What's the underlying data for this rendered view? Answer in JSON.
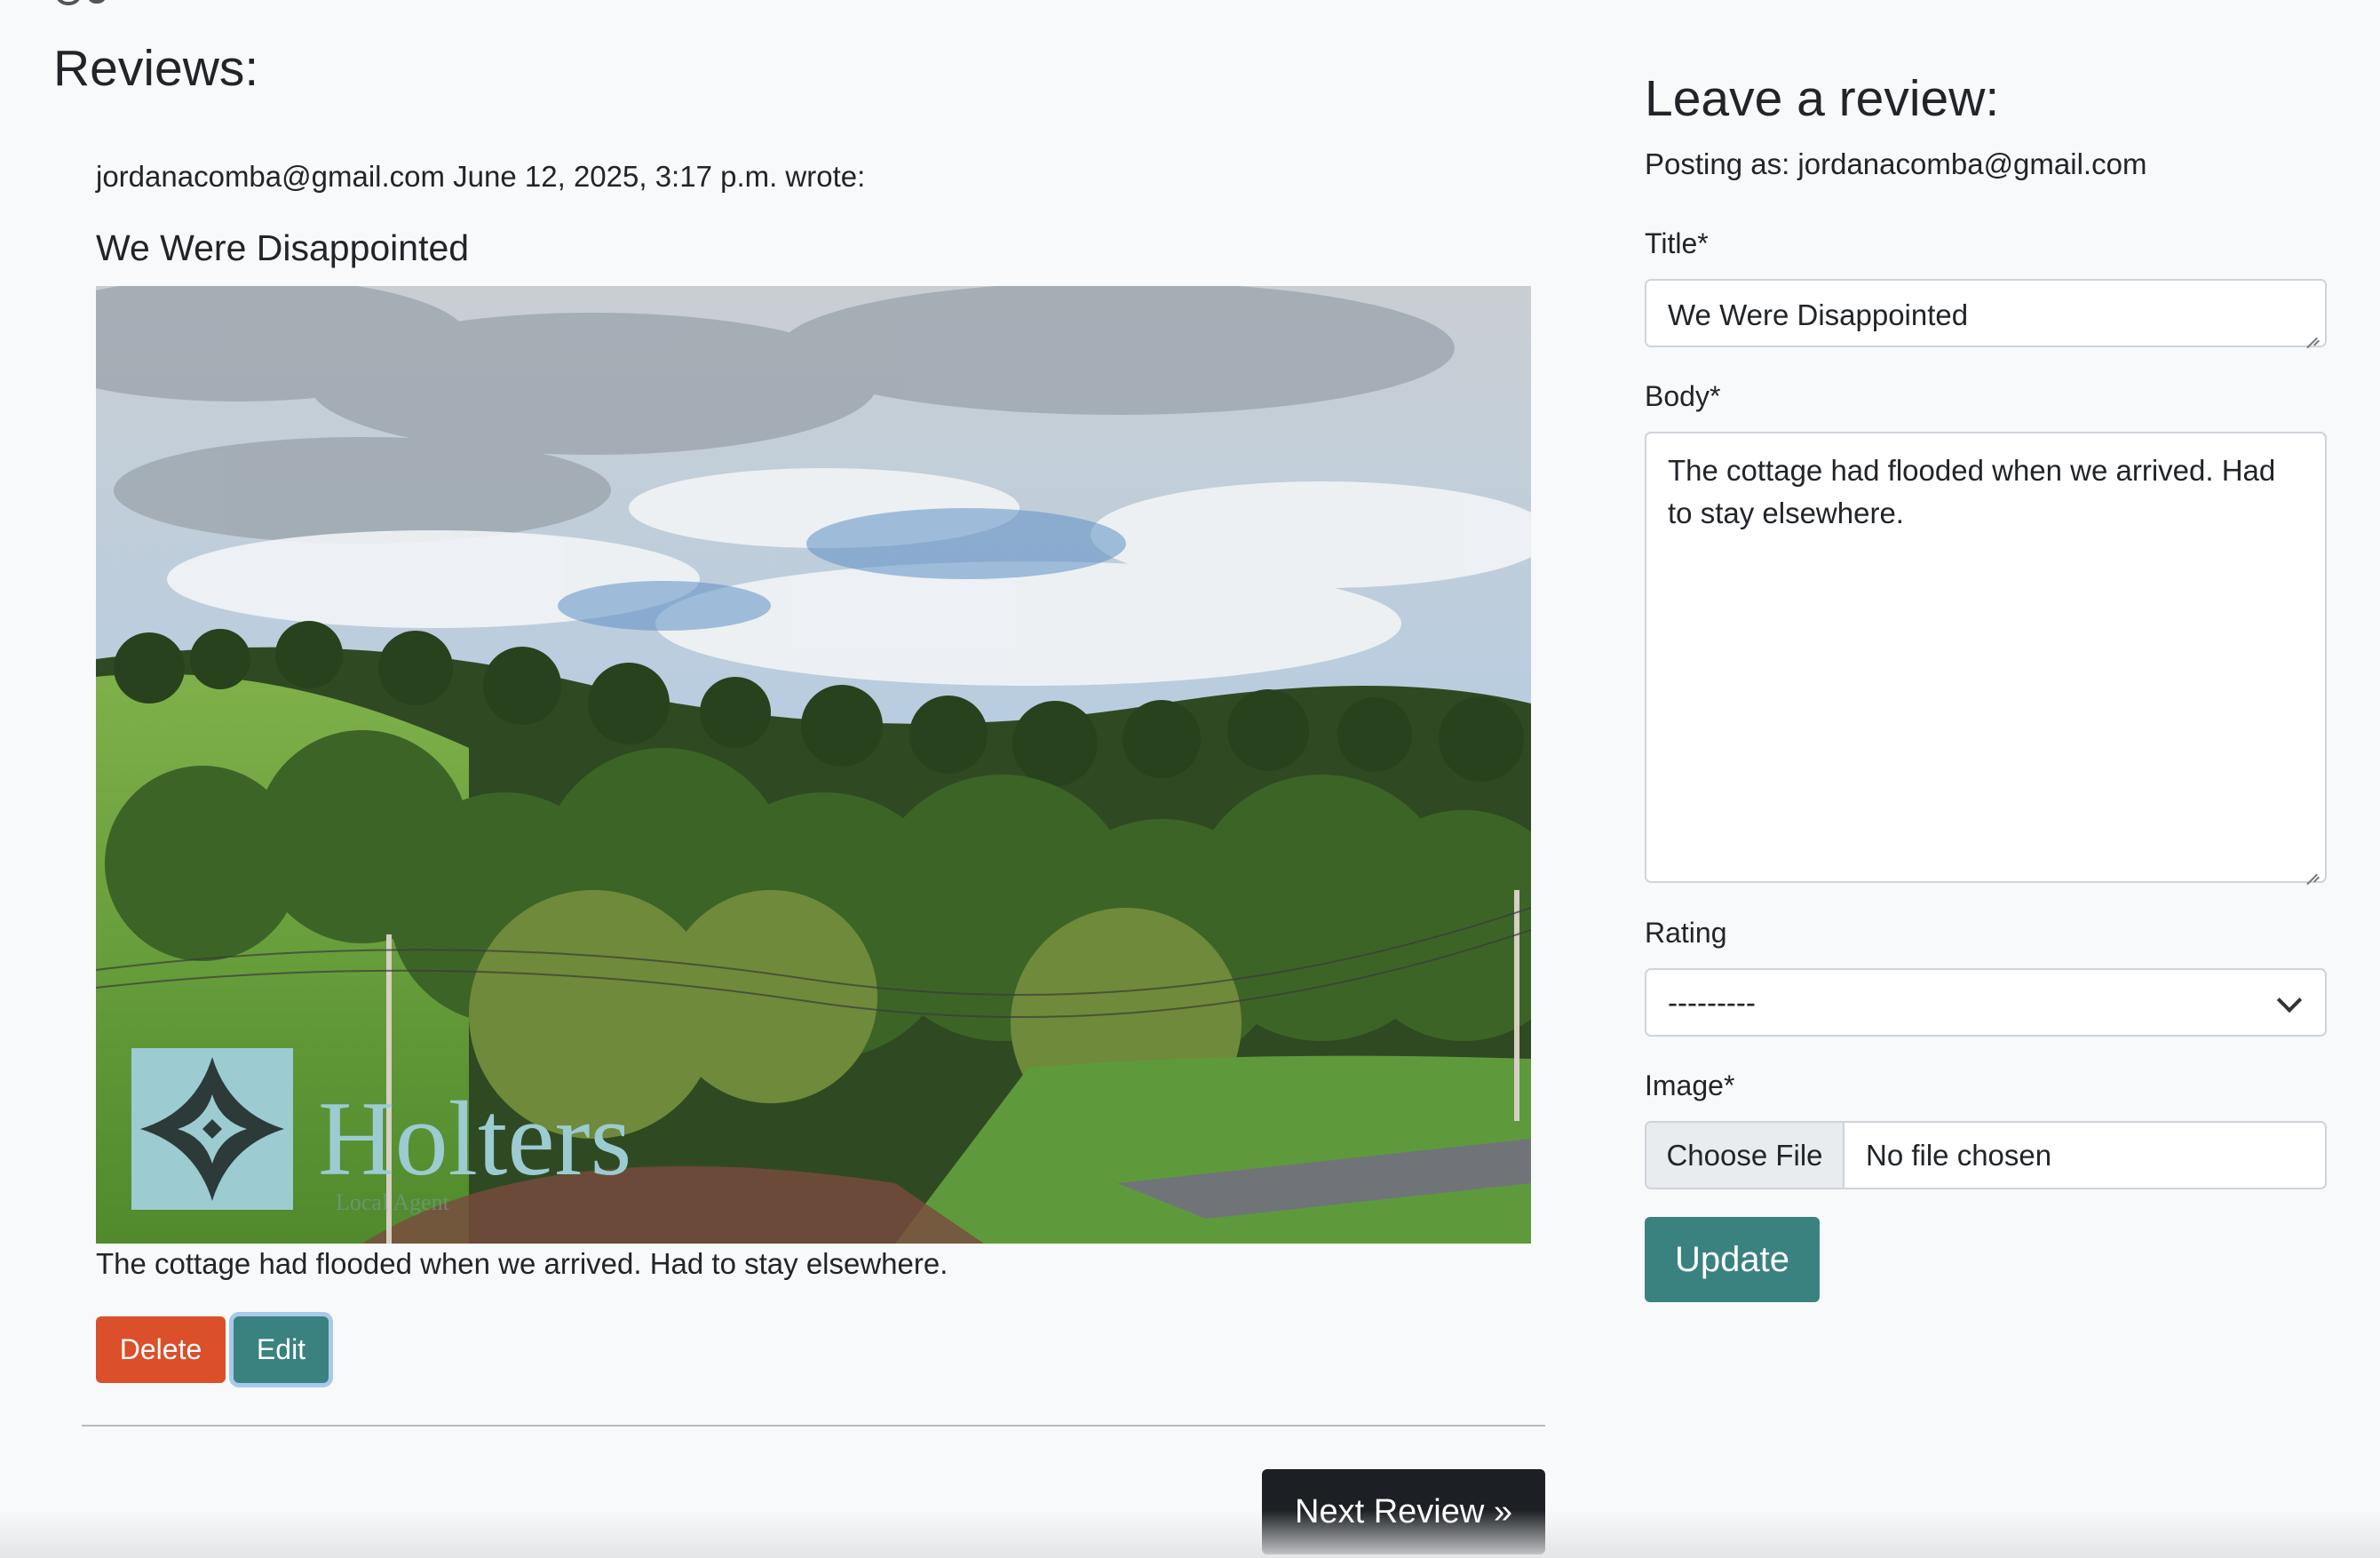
{
  "reviews": {
    "heading": "Reviews:",
    "meta": "jordanacomba@gmail.com June 12, 2025, 3:17 p.m. wrote:",
    "title": "We Were Disappointed",
    "image_watermark": "Holters",
    "image_watermark_tagline": "Local Agent",
    "body": "The cottage had flooded when we arrived. Had to stay elsewhere.",
    "delete_label": "Delete",
    "edit_label": "Edit",
    "next_label": "Next Review »"
  },
  "form": {
    "heading": "Leave a review:",
    "posting_as": "Posting as: jordanacomba@gmail.com",
    "title_label": "Title*",
    "title_value": "We Were Disappointed",
    "body_label": "Body*",
    "body_value": "The cottage had flooded when we arrived. Had to stay elsewhere.",
    "rating_label": "Rating",
    "rating_value": "---------",
    "image_label": "Image*",
    "choose_file_label": "Choose File",
    "file_status": "No file chosen",
    "submit_label": "Update"
  },
  "colors": {
    "delete": "#db4f2b",
    "teal": "#3a8280",
    "dark_button": "#1c1f23",
    "background": "#f8f9fa"
  }
}
